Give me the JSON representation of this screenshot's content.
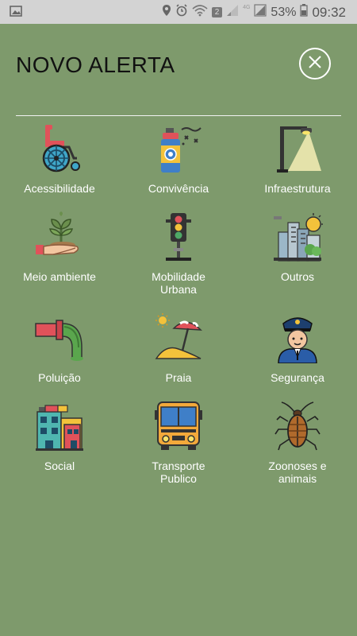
{
  "status_bar": {
    "network_badge": "2",
    "signal_label": "4G",
    "battery_percent": "53%",
    "time": "09:32"
  },
  "header": {
    "title": "NOVO ALERTA",
    "close_icon": "close-icon"
  },
  "categories": [
    {
      "label": "Acessibilidade",
      "icon": "wheelchair-icon"
    },
    {
      "label": "Convivência",
      "icon": "spray-can-icon"
    },
    {
      "label": "Infraestrutura",
      "icon": "street-lamp-icon"
    },
    {
      "label": "Meio ambiente",
      "icon": "plant-hand-icon"
    },
    {
      "label": "Mobilidade\nUrbana",
      "icon": "traffic-light-icon"
    },
    {
      "label": "Outros",
      "icon": "city-icon"
    },
    {
      "label": "Poluição",
      "icon": "pipe-icon"
    },
    {
      "label": "Praia",
      "icon": "beach-icon"
    },
    {
      "label": "Segurança",
      "icon": "police-officer-icon"
    },
    {
      "label": "Social",
      "icon": "buildings-icon"
    },
    {
      "label": "Transporte\nPublico",
      "icon": "bus-icon"
    },
    {
      "label": "Zoonoses e\nanimais",
      "icon": "cockroach-icon"
    }
  ],
  "colors": {
    "background": "#7e9a6c",
    "status_bar": "#d3d3d3"
  }
}
